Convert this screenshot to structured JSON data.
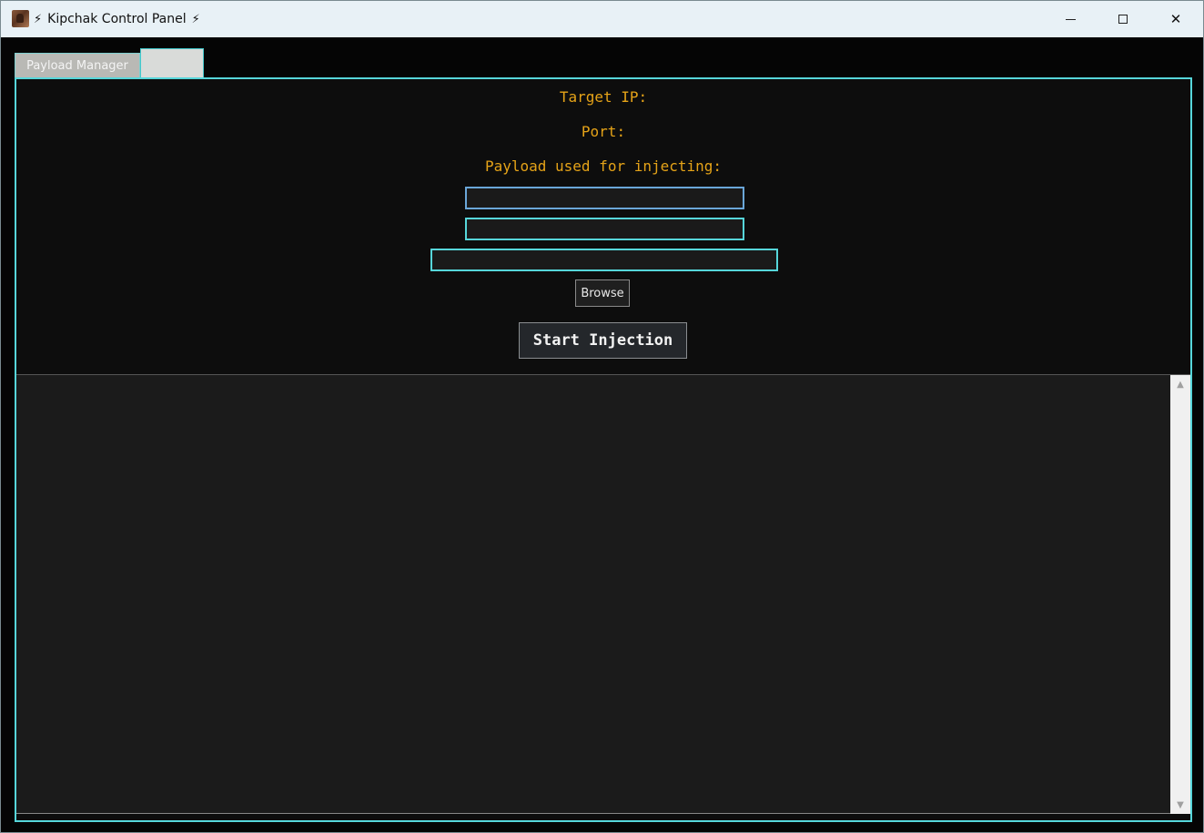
{
  "window": {
    "title": "Kipchak Control Panel",
    "title_prefix_icon": "⚡",
    "title_suffix_icon": "⚡",
    "app_icon": "app-logo-icon",
    "controls": {
      "minimize_icon": "minimize-icon",
      "maximize_icon": "maximize-icon",
      "close_icon": "close-icon",
      "close_glyph": "✕"
    }
  },
  "tabs": [
    {
      "label": "Payload Manager",
      "active": false
    },
    {
      "label": "",
      "active": true
    }
  ],
  "form": {
    "target_ip_label": "Target IP:",
    "port_label": "Port:",
    "payload_label": "Payload used for injecting:",
    "target_ip_value": "",
    "port_value": "",
    "payload_value": "",
    "browse_label": "Browse",
    "start_label": "Start Injection"
  },
  "log": {
    "content": "",
    "scroll_up_glyph": "▲",
    "scroll_down_glyph": "▼"
  },
  "colors": {
    "accent": "#56d6da",
    "label": "#e5a318",
    "panel_bg": "#0d0d0d",
    "log_bg": "#1b1b1b"
  }
}
